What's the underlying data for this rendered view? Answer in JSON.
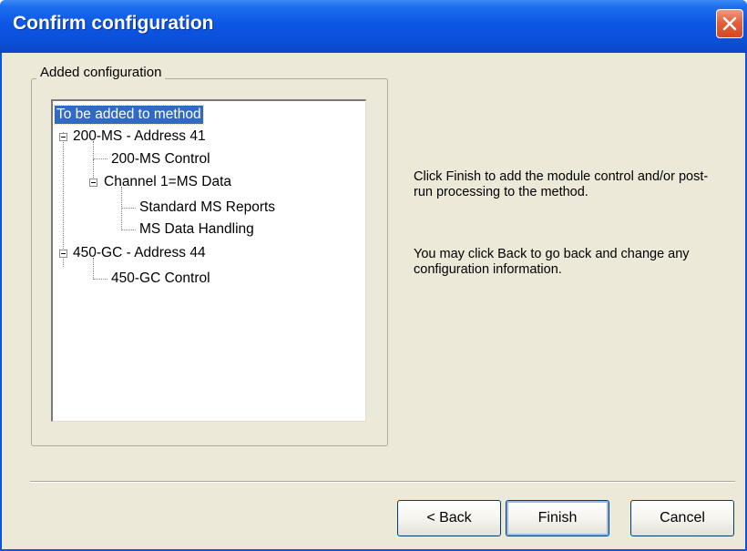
{
  "window": {
    "title": "Confirm configuration"
  },
  "group": {
    "label": "Added configuration"
  },
  "tree": {
    "root": "To be added to method",
    "nodes": {
      "ms_module": "200-MS - Address 41",
      "ms_control": "200-MS Control",
      "channel": "Channel 1=MS Data",
      "ms_reports": "Standard MS Reports",
      "ms_data_handling": "MS Data Handling",
      "gc_module": "450-GC - Address 44",
      "gc_control": "450-GC Control"
    }
  },
  "info": {
    "finish_text": "Click Finish to add the module control and/or post-run processing to the method.",
    "back_text": "You may click Back to go back and change any configuration information."
  },
  "buttons": {
    "back": "< Back",
    "finish": "Finish",
    "cancel": "Cancel"
  },
  "colors": {
    "titlebar": "#0a4fd8",
    "selection": "#316ac5",
    "dialog_bg": "#ece9d8",
    "close": "#d24a24"
  }
}
